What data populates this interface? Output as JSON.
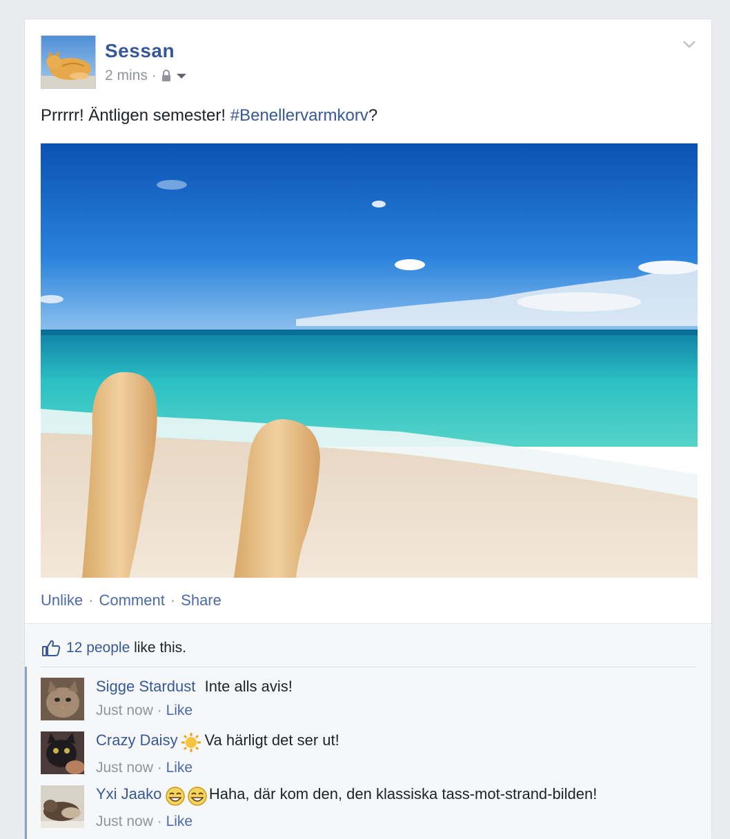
{
  "post": {
    "author": "Sessan",
    "time": "2 mins",
    "separator": "·",
    "text_prefix": "Prrrrr! Äntligen semester! ",
    "hashtag": "#Benellervarmkorv",
    "text_suffix": "?"
  },
  "actions": {
    "unlike": "Unlike",
    "comment": "Comment",
    "share": "Share",
    "separator": "·"
  },
  "likes": {
    "count_text": "12 people",
    "suffix": " like this."
  },
  "comments": [
    {
      "name": "Sigge Stardust",
      "text": "Inte alls avis!",
      "time": "Just now",
      "like": "Like"
    },
    {
      "name": "Crazy Daisy",
      "text": "Va härligt det ser ut!",
      "time": "Just now",
      "like": "Like",
      "icon": "sun-icon"
    },
    {
      "name": "Yxi Jaako",
      "text": "Haha, där kom den, den klassiska tass-mot-strand-bilden!",
      "time": "Just now",
      "like": "Like",
      "icon": "laughing-emoji-icon"
    }
  ],
  "colors": {
    "link": "#365899",
    "text": "#1d2129",
    "meta": "#90949c",
    "background": "#e9ebee"
  }
}
